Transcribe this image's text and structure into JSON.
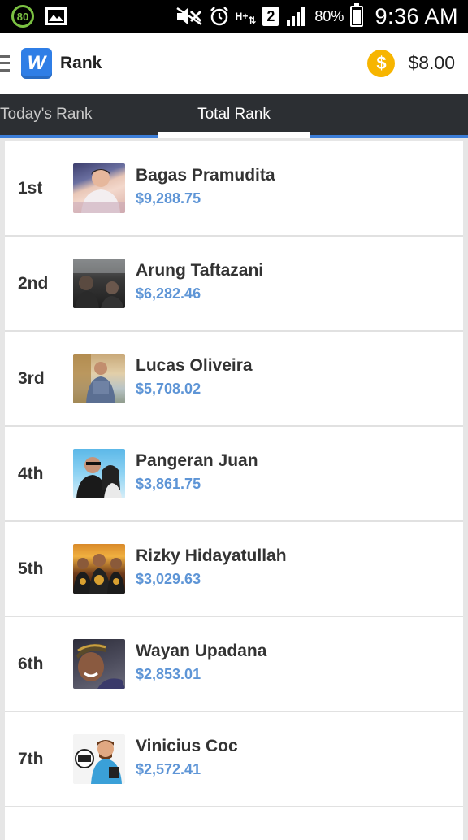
{
  "status_bar": {
    "badge": "80",
    "network": "H+",
    "sim": "2",
    "battery_pct": "80%",
    "battery_level": 0.8,
    "time": "9:36 AM"
  },
  "app_bar": {
    "title": "Rank",
    "logo_letter": "W",
    "coin_symbol": "$",
    "balance": "$8.00"
  },
  "tabs": [
    {
      "label": "Today's Rank",
      "active": false
    },
    {
      "label": "Total Rank",
      "active": true
    }
  ],
  "ranking": [
    {
      "rank": "1st",
      "name": "Bagas Pramudita",
      "amount": "$9,288.75"
    },
    {
      "rank": "2nd",
      "name": "Arung Taftazani",
      "amount": "$6,282.46"
    },
    {
      "rank": "3rd",
      "name": "Lucas Oliveira",
      "amount": "$5,708.02"
    },
    {
      "rank": "4th",
      "name": "Pangeran Juan",
      "amount": "$3,861.75"
    },
    {
      "rank": "5th",
      "name": "Rizky Hidayatullah",
      "amount": "$3,029.63"
    },
    {
      "rank": "6th",
      "name": "Wayan Upadana",
      "amount": "$2,853.01"
    },
    {
      "rank": "7th",
      "name": "Vinicius Coc",
      "amount": "$2,572.41"
    }
  ],
  "colors": {
    "accent": "#3b7dd8",
    "amount": "#5e95d6",
    "coin": "#f7b500",
    "tab_bar": "#2c2f33"
  }
}
